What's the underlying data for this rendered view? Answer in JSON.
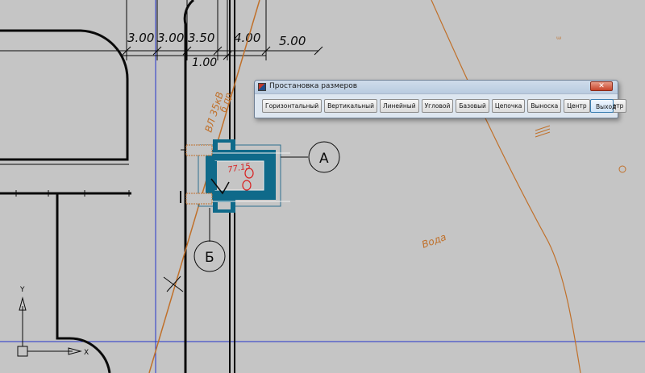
{
  "drawing": {
    "dimensions": [
      "3.00",
      "3.00",
      "3.50",
      "4.00",
      "5.00",
      "1.00"
    ],
    "axis_labels": {
      "a": "А",
      "b": "Б"
    },
    "power_line_label": "ВЛ 35кВ",
    "power_line_sub": "б пр.",
    "elevation_mark": "77.15",
    "water_label": "Вода",
    "ucs": {
      "x": "X",
      "y": "Y"
    },
    "colors": {
      "background": "#c5c5c5",
      "line": "#0a0a0a",
      "river": "#c0702a",
      "grid_blue": "#2233cc",
      "structure": "#0f6a8a",
      "annotation_red": "#d81f1f"
    }
  },
  "dialog": {
    "title": "Простановка размеров",
    "close_glyph": "✕",
    "buttons": [
      "Горизонтальный",
      "Вертикальный",
      "Линейный",
      "Угловой",
      "Базовый",
      "Цепочка",
      "Выноска",
      "Центр",
      "Диаметр"
    ],
    "exit_label": "Выход"
  }
}
